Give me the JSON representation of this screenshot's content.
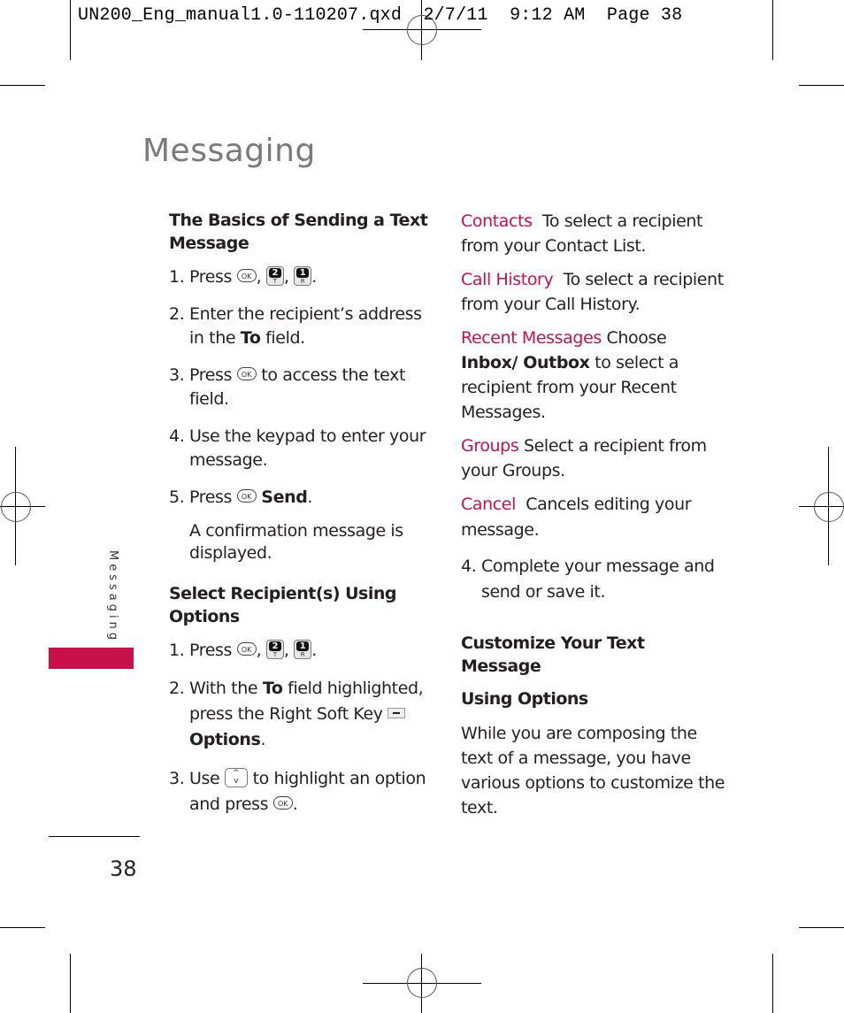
{
  "slug": "UN200_Eng_manual1.0-110207.qxd  2/7/11  9:12 AM  Page 38",
  "page_title": "Messaging",
  "side_tab": "Messaging",
  "page_number": "38",
  "accent_color": "#c8104a",
  "icons": {
    "ok_key": "OK",
    "key2_top": "2",
    "key2_bottom": "T",
    "key1_top": "1",
    "key1_bottom": "R",
    "nav_up": "^",
    "nav_down": "v"
  },
  "left": {
    "section1": {
      "heading": "The Basics of Sending a Text Message",
      "steps": [
        {
          "num": "1.",
          "pre": "Press",
          "sep1": ",",
          "sep2": ",",
          "end": "."
        },
        {
          "num": "2.",
          "pre": "Enter the recipient’s address in the ",
          "bold": "To",
          "post": " field."
        },
        {
          "num": "3.",
          "pre": "Press",
          "post": " to access the text field."
        },
        {
          "num": "4.",
          "text": "Use the keypad to enter your message."
        },
        {
          "num": "5.",
          "pre": "Press",
          "bold": "Send",
          "post": "."
        }
      ],
      "note": "A confirmation message is displayed."
    },
    "section2": {
      "heading": "Select Recipient(s) Using Options",
      "steps": [
        {
          "num": "1.",
          "pre": "Press",
          "sep1": ",",
          "sep2": ",",
          "end": "."
        },
        {
          "num": "2.",
          "pre": "With the ",
          "bold": "To",
          "mid": " field highlighted, press the Right Soft Key ",
          "bold2": "Options",
          "post": "."
        },
        {
          "num": "3.",
          "pre": "Use",
          "mid": " to highlight an option and press",
          "post": "."
        }
      ]
    }
  },
  "right": {
    "options": [
      {
        "label": "Contacts",
        "desc": "To select a recipient from your Contact List."
      },
      {
        "label": "Call History",
        "desc": "To select a recipient from your Call History."
      },
      {
        "label": "Recent Messages",
        "desc_pre": "Choose ",
        "desc_bold": "Inbox/ Outbox",
        "desc_post": " to select a recipient from your Recent Messages."
      },
      {
        "label": "Groups",
        "desc": "Select a recipient from your Groups."
      },
      {
        "label": "Cancel",
        "desc": "Cancels editing your message."
      }
    ],
    "step4": {
      "num": "4.",
      "text": "Complete your message and send or save it."
    },
    "section3": {
      "heading_line1": "Customize Your Text Message",
      "heading_line2": "Using Options",
      "body": "While you are composing the text of a message, you have various options to customize the text."
    }
  }
}
